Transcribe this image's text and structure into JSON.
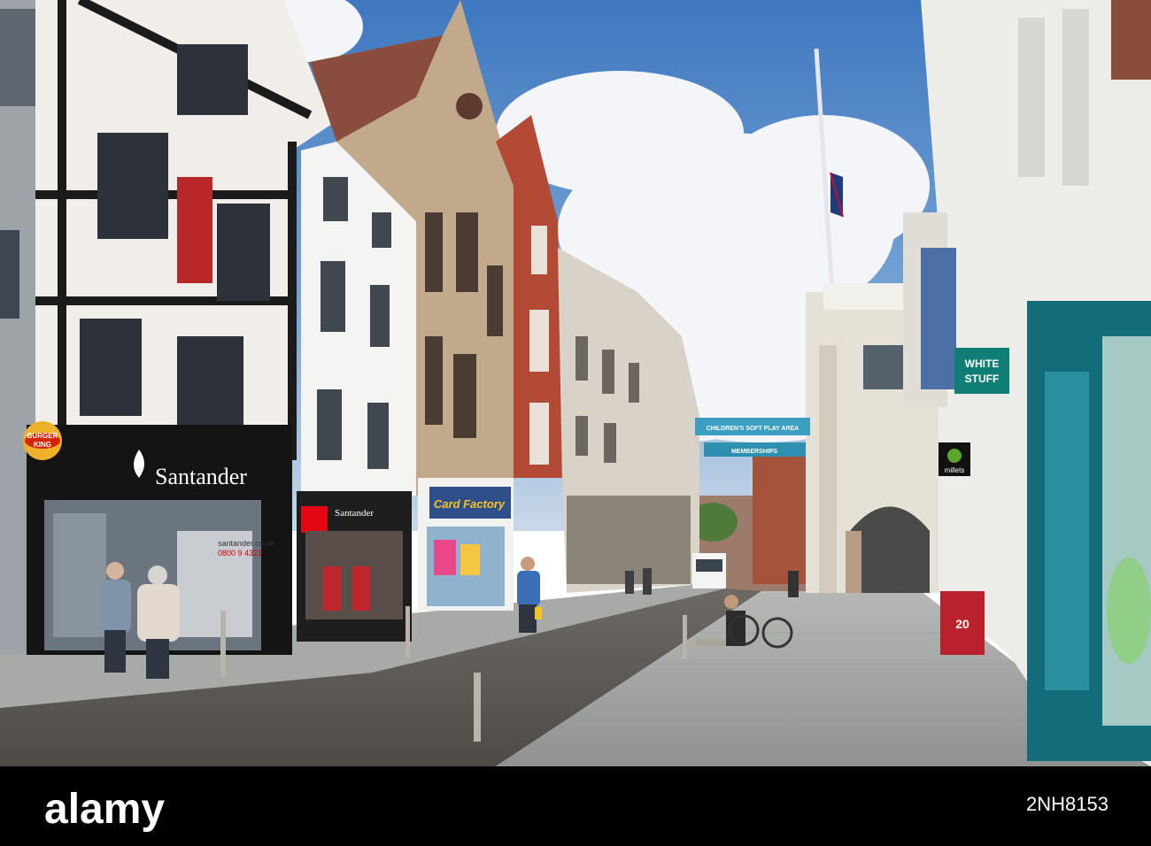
{
  "signs": {
    "burger_king_line1": "BURGER",
    "burger_king_line2": "KING",
    "santander_main": "Santander",
    "santander_small": "Santander",
    "santander_web": "santander.co.uk",
    "santander_phone": "0800 9 4321",
    "card_factory": "Card Factory",
    "white_stuff_line1": "WHITE",
    "white_stuff_line2": "STUFF",
    "millets": "millets",
    "banner1": "CHILDREN'S SOFT PLAY AREA",
    "banner2": "MEMBERSHIPS",
    "aboard_number": "20"
  },
  "footer": {
    "brand": "alamy",
    "image_id": "2NH8153"
  },
  "colors": {
    "sky": "#4f86c6",
    "footer_bg": "#000000",
    "santander_red": "#e30613",
    "white_stuff_teal": "#0f7f75",
    "millets_green": "#5aa82b"
  }
}
